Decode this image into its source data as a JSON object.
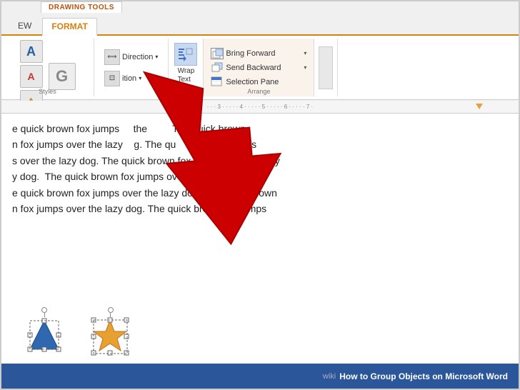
{
  "ribbon": {
    "drawing_tools_label": "DRAWING TOOLS",
    "tabs": [
      {
        "label": "EW",
        "active": false
      },
      {
        "label": "FORMAT",
        "active": true
      }
    ],
    "groups": {
      "styles": {
        "label": "Styles",
        "buttons": [
          "A",
          "A",
          "A",
          "G"
        ]
      },
      "text": {
        "direction_label": "Direction",
        "position_label": "ition",
        "wrap_text_label": "Wrap\nText"
      },
      "arrange": {
        "label": "Arrange",
        "bring_forward": "Bring Forward",
        "send_backward": "Send Backward",
        "selection_pane": "Selection Pane"
      }
    }
  },
  "ruler": {
    "ticks": [
      "3",
      "4",
      "5",
      "6",
      "7"
    ]
  },
  "document": {
    "text": "e quick brown fox jumps     the        The quick brown\nn fox jumps over the lazy     g. The qu      own fox jumps\ns over the lazy dog. The quick brown fox jumps over the lazy\ny dog.  The quick brown fox jumps over the lazy dog. The\ne quick brown fox jumps over the lazy dog. The quick brown\nn fox jumps over the lazy dog. The quick brown fox jumps"
  },
  "bottom_bar": {
    "wiki_label": "wiki",
    "how_to_label": "How to Group Objects on Microsoft Word"
  },
  "colors": {
    "accent": "#d4820f",
    "ribbon_bg": "#f0f0f0",
    "active_tab": "#d4820f",
    "doc_bg": "#ffffff",
    "bottom_bar": "#2b579a",
    "arrow_red": "#cc0000",
    "bring_forward_highlight": "#f9f3ec"
  }
}
